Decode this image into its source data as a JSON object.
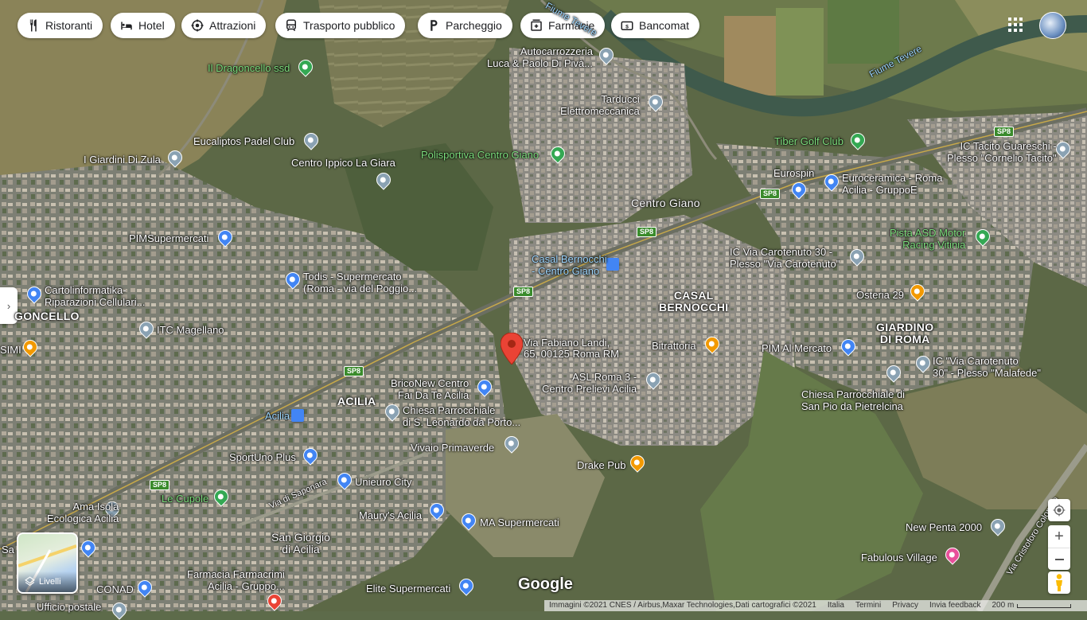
{
  "toolbar": {
    "chips": [
      "Ristoranti",
      "Hotel",
      "Attrazioni",
      "Trasporto pubblico",
      "Parcheggio",
      "Farmacie",
      "Bancomat"
    ]
  },
  "address_pin": {
    "line1": "Via Fabiano Landi,",
    "line2": "65, 00125 Roma RM"
  },
  "places": {
    "autocarrozzeria": "Autocarrozzeria\nLuca & Paolo Di Pivà...",
    "tarducci": "Tarducci\nElettromeccanica",
    "dragoncello": "Il Dragoncello ssd",
    "eucaliptos": "Eucaliptos Padel Club",
    "giardini_zula": "I Giardini Di Zula",
    "centro_ippico": "Centro Ippico La Giara",
    "polisportiva": "Polisportiva Centro Giano",
    "tiber_golf": "Tiber Golf Club",
    "ic_tacito": "IC Tacito Guareschi -\nPlesso \"Cornelio Tacito\"",
    "eurospin": "Eurospin",
    "euroceramica": "Euroceramica - Roma\nAcilia - GruppoE",
    "centro_giano": "Centro Giano",
    "pimsupermercati": "PIMSupermercati",
    "pista_asd": "Pista ASD Motor\nRacing Vitinia",
    "ic_carotenuto": "IC Via Carotenuto 30 -\nPlesso \"Via Carotenuto\"",
    "casal_bernocchi_station": "Casal Bernocchi\n- Centro Giano",
    "todis": "Todis - Supermercato\n(Roma - via del Poggio...",
    "cartolinformatika": "Cartolinformatika-\nRiparazioni Cellulari...",
    "casal_bernocchi": "CASAL\nBERNOCCHI",
    "osteria": "Osteria 29",
    "goncello": "GONCELLO",
    "itc_magellano": "ITC Magellano",
    "giardino_roma": "GIARDINO\nDI ROMA",
    "bitrattoria": "Bitrattoria",
    "pim_mercato": "PIM Al Mercato",
    "simi": "SIMI",
    "ic_malafede": "IC \"Via Carotenuto\n30\" - Plesso \"Malafede\"",
    "asl": "ASL Roma 3 -\nCentro Prelievi Acilia",
    "briconew": "BricoNew Centro\nFai Da Te Acilia",
    "acilia": "ACILIA",
    "chiesa_leonardo": "Chiesa Parrocchiale\ndi S. Leonardo da Porto...",
    "chiesa_pio": "Chiesa Parrocchiale di\nSan Pio da Pietrelcina",
    "acilia_station": "Acilia",
    "vivaio": "Vivaio Primaverde",
    "sportuno": "SportUno Plus",
    "drake": "Drake Pub",
    "unieuro": "Unieuro City",
    "le_cupole": "Le Cupole",
    "via_saponara": "Via di Saponara",
    "ama_isola": "Ama Isola\nEcologica Acilia",
    "maurys": "Maury's Acilia",
    "ma_super": "MA Supermercati",
    "new_penta": "New Penta 2000",
    "san_giorgio": "San Giorgio\ndi Acilia",
    "fabulous": "Fabulous Village",
    "via_cristoforo": "Via Cristoforo Colombo",
    "farmacia": "Farmacia Farmacrimi\nAcilia - Gruppo...",
    "conad": "CONAD",
    "elite": "Elite Supermercati",
    "ufficio": "Ufficio postale",
    "sa": "Sa",
    "fiume_tevere": "Fiume Tevere",
    "fiume_tevere_2": "Fiume Tevere"
  },
  "road_shields": [
    "SP8",
    "SP8",
    "SP8",
    "SP8",
    "SP8",
    "SP8"
  ],
  "layers": {
    "label": "Livelli"
  },
  "google_logo": "Google",
  "footer": {
    "attribution": "Immagini ©2021 CNES / Airbus,Maxar Technologies,Dati cartografici ©2021",
    "country": "Italia",
    "terms": "Termini",
    "privacy": "Privacy",
    "feedback": "Invia feedback",
    "scale": "200 m"
  },
  "colors": {
    "pin_red": "#ea4335",
    "pin_blue": "#4285f4",
    "pin_green": "#34a853",
    "pin_orange": "#f29900",
    "pin_gray": "#8aa2b3",
    "pin_pink": "#e84f9a"
  },
  "icons": [
    "restaurant-icon",
    "hotel-icon",
    "attraction-icon",
    "transit-icon",
    "parking-icon",
    "pharmacy-icon",
    "atm-icon",
    "apps-grid-icon",
    "avatar",
    "layers-icon",
    "compass-icon",
    "zoom-in-icon",
    "zoom-out-icon",
    "pegman-icon",
    "collapse-panel-icon"
  ]
}
